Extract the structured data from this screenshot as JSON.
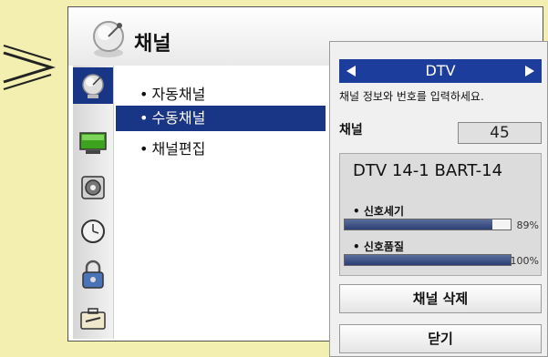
{
  "colors": {
    "background": "#f2efb0",
    "highlight": "#193585",
    "panel_header": "#1d3d9c",
    "bar_fill": "#2c3f74"
  },
  "header": {
    "icon": "satellite-dish-icon",
    "title": "채널"
  },
  "sidebar": {
    "items": [
      {
        "icon": "satellite-dish-icon",
        "active": true
      },
      {
        "icon": "monitor-icon",
        "active": false
      },
      {
        "icon": "speaker-icon",
        "active": false
      },
      {
        "icon": "clock-icon",
        "active": false
      },
      {
        "icon": "lock-icon",
        "active": false
      },
      {
        "icon": "toolbox-icon",
        "active": false
      }
    ]
  },
  "submenu": {
    "items": [
      {
        "label": "자동채널",
        "selected": false
      },
      {
        "label": "수동채널",
        "selected": true
      },
      {
        "label": "채널편집",
        "selected": false
      }
    ]
  },
  "panel": {
    "mode": "DTV",
    "instruction": "채널 정보와 번호를 입력하세요.",
    "channel_label": "채널",
    "channel_value": "45",
    "channel_name": "DTV 14-1 BART-14",
    "signal_strength": {
      "label": "• 신호세기",
      "value": 89,
      "value_text": "89%"
    },
    "signal_quality": {
      "label": "• 신호품질",
      "value": 100,
      "value_text": "100%"
    },
    "delete_button": "채널 삭제",
    "close_button": "닫기"
  }
}
